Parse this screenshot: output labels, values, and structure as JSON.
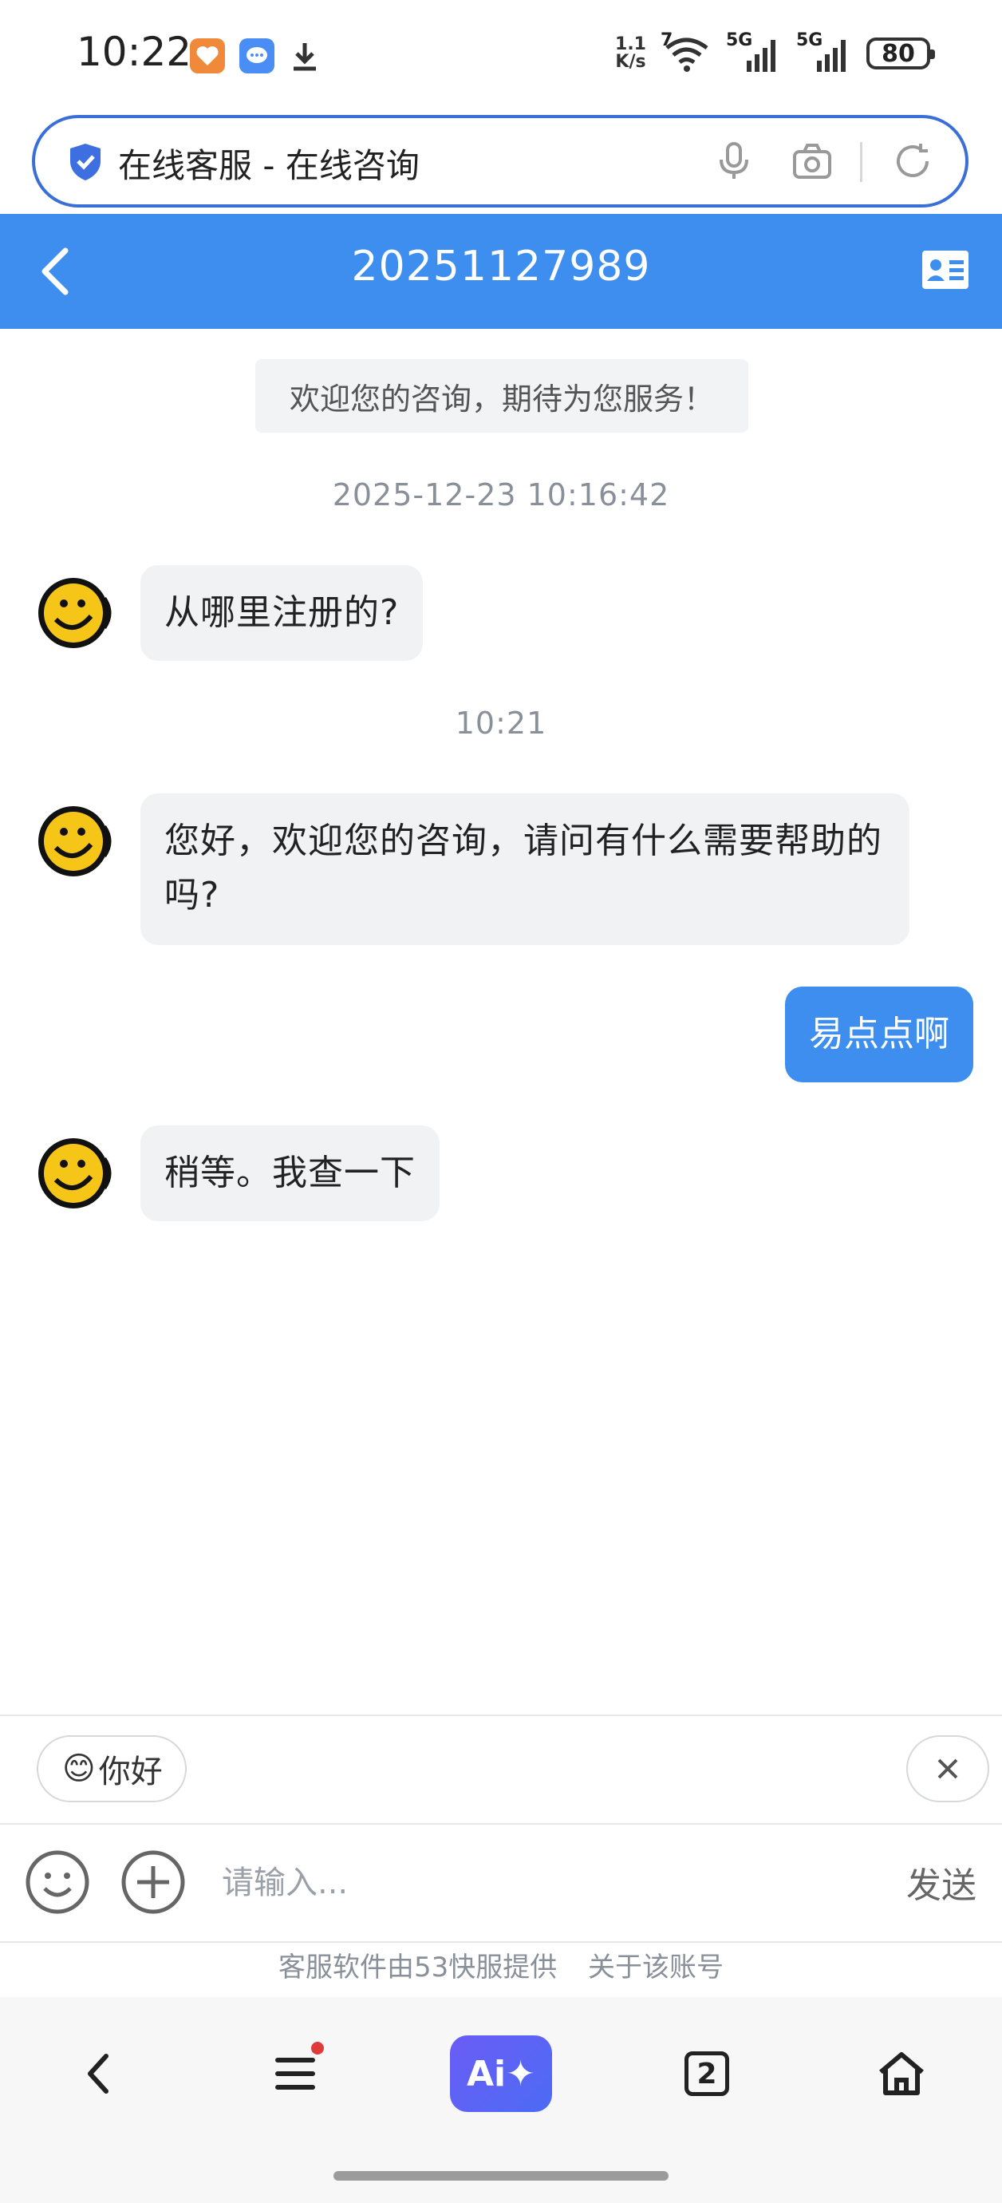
{
  "status_bar": {
    "time": "10:22",
    "net_speed_value": "1.1",
    "net_speed_unit": "K/s",
    "wifi_badge": "7",
    "network1": "5G",
    "network2": "5G",
    "battery": "80"
  },
  "browser": {
    "page_title": "在线客服 - 在线咨询"
  },
  "header": {
    "title": "20251127989",
    "accent_color": "#3e8ef0"
  },
  "chat": {
    "welcome": "欢迎您的咨询，期待为您服务！",
    "messages": [
      {
        "type": "time",
        "text": "2025-12-23 10:16:42"
      },
      {
        "type": "agent",
        "text": "从哪里注册的?"
      },
      {
        "type": "time",
        "text": "10:21"
      },
      {
        "type": "agent",
        "text": "您好，欢迎您的咨询，请问有什么需要帮助的吗?"
      },
      {
        "type": "user",
        "text": "易点点啊"
      },
      {
        "type": "agent",
        "text": "稍等。我查一下"
      }
    ]
  },
  "quick_reply": {
    "emoji": "😊",
    "label": "你好"
  },
  "input": {
    "placeholder": "请输入...",
    "send_label": "发送"
  },
  "footer": {
    "powered_by": "客服软件由53快服提供",
    "about": "关于该账号"
  },
  "bottom_nav": {
    "ai_label": "Ai✦",
    "tab_count": "2"
  }
}
